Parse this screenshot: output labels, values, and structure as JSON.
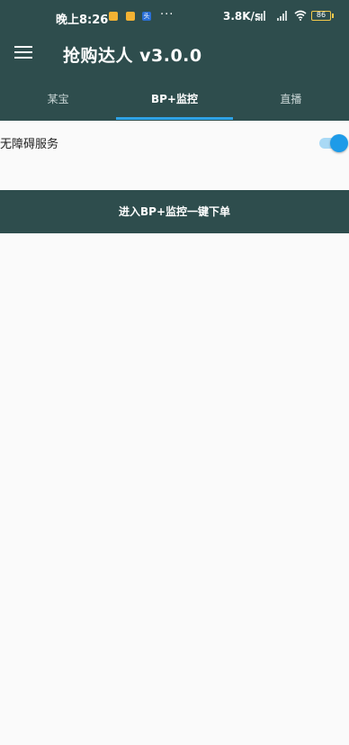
{
  "status_bar": {
    "time": "晚上8:26",
    "notif_badge": "头",
    "more_dots": "···",
    "net_speed": "3.8K/s",
    "wifi_icon": "wifi-icon",
    "battery": "86"
  },
  "app_bar": {
    "title": "抢购达人 v3.0.0",
    "menu_icon": "hamburger-menu-icon"
  },
  "tabs": [
    {
      "label": "某宝",
      "active": false
    },
    {
      "label": "BP+监控",
      "active": true
    },
    {
      "label": "直播",
      "active": false
    }
  ],
  "settings": {
    "accessibility_label": "无障碍服务",
    "accessibility_enabled": true
  },
  "cta": {
    "label": "进入BP+监控一键下单"
  },
  "colors": {
    "primary": "#2e4d4d",
    "accent": "#1e9be8",
    "tab_indicator": "#2fa3e6",
    "background": "#fafafa"
  }
}
